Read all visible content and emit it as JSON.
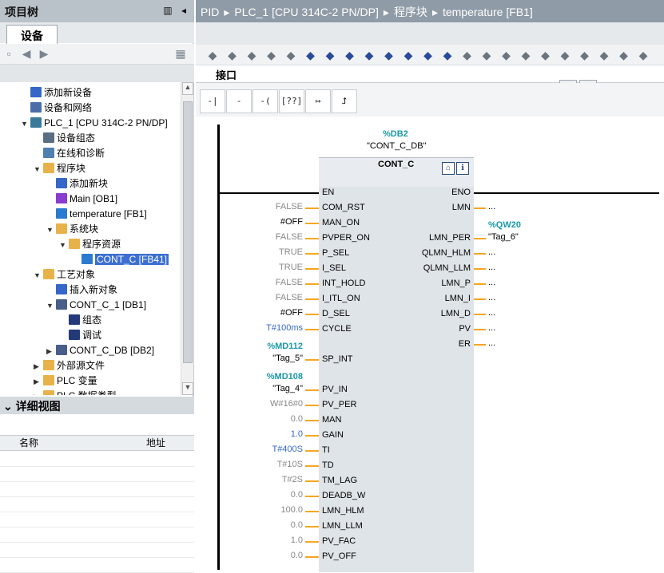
{
  "left_panel": {
    "title": "项目树",
    "device_tab": "设备",
    "tree": [
      {
        "label": "添加新设备",
        "indent": 0,
        "icon": "add-device-icon"
      },
      {
        "label": "设备和网络",
        "indent": 0,
        "icon": "network-icon"
      },
      {
        "label": "PLC_1 [CPU 314C-2 PN/DP]",
        "indent": 0,
        "icon": "plc-icon",
        "expanded": true
      },
      {
        "label": "设备组态",
        "indent": 1,
        "icon": "device-config-icon"
      },
      {
        "label": "在线和诊断",
        "indent": 1,
        "icon": "diagnostics-icon"
      },
      {
        "label": "程序块",
        "indent": 1,
        "icon": "folder-icon",
        "expanded": true
      },
      {
        "label": "添加新块",
        "indent": 2,
        "icon": "add-block-icon"
      },
      {
        "label": "Main [OB1]",
        "indent": 2,
        "icon": "ob-icon"
      },
      {
        "label": "temperature [FB1]",
        "indent": 2,
        "icon": "fb-icon"
      },
      {
        "label": "系统块",
        "indent": 2,
        "icon": "folder-icon",
        "expanded": true
      },
      {
        "label": "程序资源",
        "indent": 3,
        "icon": "folder-icon",
        "expanded": true
      },
      {
        "label": "CONT_C [FB41]",
        "indent": 4,
        "icon": "fb-icon",
        "selected": true
      },
      {
        "label": "工艺对象",
        "indent": 1,
        "icon": "folder-icon",
        "expanded": true
      },
      {
        "label": "插入新对象",
        "indent": 2,
        "icon": "add-object-icon"
      },
      {
        "label": "CONT_C_1 [DB1]",
        "indent": 2,
        "icon": "technology-icon",
        "expanded": true
      },
      {
        "label": "组态",
        "indent": 3,
        "icon": "config-icon"
      },
      {
        "label": "调试",
        "indent": 3,
        "icon": "commissioning-icon"
      },
      {
        "label": "CONT_C_DB [DB2]",
        "indent": 2,
        "icon": "technology-icon"
      },
      {
        "label": "外部源文件",
        "indent": 1,
        "icon": "folder-icon"
      },
      {
        "label": "PLC 变量",
        "indent": 1,
        "icon": "folder-icon"
      },
      {
        "label": "PLC 数据类型",
        "indent": 1,
        "icon": "folder-icon"
      }
    ],
    "detail_view": {
      "title": "详细视图",
      "col_name": "名称",
      "col_address": "地址"
    }
  },
  "breadcrumb": [
    "PID",
    "PLC_1 [CPU 314C-2 PN/DP]",
    "程序块",
    "temperature [FB1]"
  ],
  "interface_label": "接口",
  "ladder_tools": [
    "-| |-",
    "-|/|-",
    "-( )-",
    "[??]",
    "↦",
    "⮥"
  ],
  "block": {
    "db_address": "%DB2",
    "db_name": "\"CONT_C_DB\"",
    "name": "CONT_C",
    "inputs": [
      {
        "pin": "EN",
        "value": ""
      },
      {
        "pin": "COM_RST",
        "value": "FALSE",
        "style": "gray"
      },
      {
        "pin": "MAN_ON",
        "value": "#OFF",
        "style": "plain"
      },
      {
        "pin": "PVPER_ON",
        "value": "FALSE",
        "style": "gray"
      },
      {
        "pin": "P_SEL",
        "value": "TRUE",
        "style": "gray"
      },
      {
        "pin": "I_SEL",
        "value": "TRUE",
        "style": "gray"
      },
      {
        "pin": "INT_HOLD",
        "value": "FALSE",
        "style": "gray"
      },
      {
        "pin": "I_ITL_ON",
        "value": "FALSE",
        "style": "gray"
      },
      {
        "pin": "D_SEL",
        "value": "#OFF",
        "style": "plain"
      },
      {
        "pin": "CYCLE",
        "value": "T#100ms",
        "style": "blue"
      },
      {
        "pin": "SP_INT",
        "value": "\"Tag_5\"",
        "addr": "%MD112",
        "style": "plain"
      },
      {
        "pin": "PV_IN",
        "value": "\"Tag_4\"",
        "addr": "%MD108",
        "style": "plain"
      },
      {
        "pin": "PV_PER",
        "value": "W#16#0",
        "style": "gray"
      },
      {
        "pin": "MAN",
        "value": "0.0",
        "style": "gray"
      },
      {
        "pin": "GAIN",
        "value": "1.0",
        "style": "blue"
      },
      {
        "pin": "TI",
        "value": "T#400S",
        "style": "blue"
      },
      {
        "pin": "TD",
        "value": "T#10S",
        "style": "gray"
      },
      {
        "pin": "TM_LAG",
        "value": "T#2S",
        "style": "gray"
      },
      {
        "pin": "DEADB_W",
        "value": "0.0",
        "style": "gray"
      },
      {
        "pin": "LMN_HLM",
        "value": "100.0",
        "style": "gray"
      },
      {
        "pin": "LMN_LLM",
        "value": "0.0",
        "style": "gray"
      },
      {
        "pin": "PV_FAC",
        "value": "1.0",
        "style": "gray"
      },
      {
        "pin": "PV_OFF",
        "value": "0.0",
        "style": "gray"
      }
    ],
    "outputs": [
      {
        "pin": "ENO",
        "value": ""
      },
      {
        "pin": "LMN",
        "value": "..."
      },
      {
        "pin": "LMN_PER",
        "value": "\"Tag_6\"",
        "addr": "%QW20"
      },
      {
        "pin": "QLMN_HLM",
        "value": "..."
      },
      {
        "pin": "QLMN_LLM",
        "value": "..."
      },
      {
        "pin": "LMN_P",
        "value": "..."
      },
      {
        "pin": "LMN_I",
        "value": "..."
      },
      {
        "pin": "LMN_D",
        "value": "..."
      },
      {
        "pin": "PV",
        "value": "..."
      },
      {
        "pin": "ER",
        "value": "..."
      }
    ]
  },
  "colors": {
    "accent_orange": "#f5a623",
    "teal_address": "#1a9aa8",
    "blue_value": "#3568c8",
    "selected": "#3c6fd0"
  }
}
